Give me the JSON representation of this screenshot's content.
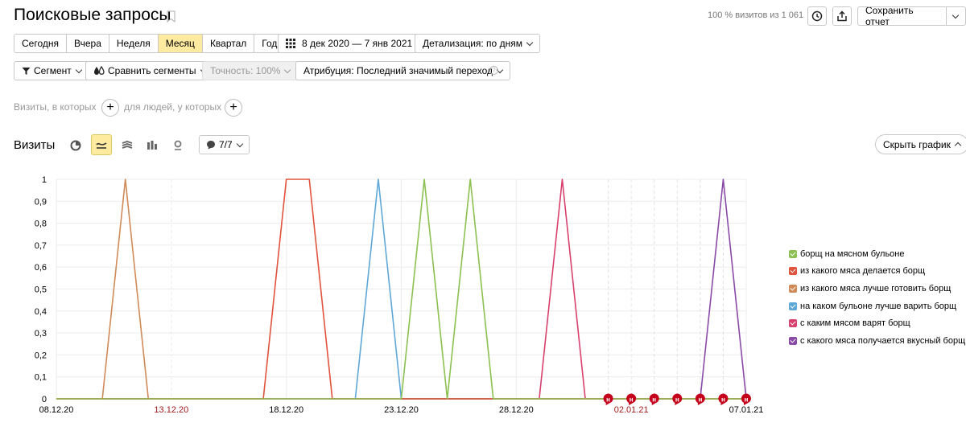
{
  "page": {
    "title": "Поисковые запросы",
    "visits_info": "100 % визитов из 1 061",
    "save_report": "Сохранить отчет"
  },
  "periods": [
    "Сегодня",
    "Вчера",
    "Неделя",
    "Месяц",
    "Квартал",
    "Год"
  ],
  "active_period": "Месяц",
  "date_range": "8 дек 2020 — 7 янв 2021",
  "detail": "Детализация: по дням",
  "filters": {
    "segment": "Сегмент",
    "compare": "Сравнить сегменты",
    "accuracy": "Точность: 100%",
    "attribution": "Атрибуция: Последний значимый переход",
    "visits_where": "Визиты, в которых",
    "people_where": "для людей, у которых"
  },
  "chart_section": {
    "title": "Визиты",
    "series_count": "7/7",
    "hide_chart": "Скрыть график"
  },
  "colors": {
    "active_bg": "#ffeba0",
    "holiday_red": "#a01a1a",
    "marker_red": "#c5001a"
  },
  "chart_data": {
    "type": "line",
    "title": "",
    "x": [
      "08.12.20",
      "09.12.20",
      "10.12.20",
      "11.12.20",
      "12.12.20",
      "13.12.20",
      "14.12.20",
      "15.12.20",
      "16.12.20",
      "17.12.20",
      "18.12.20",
      "19.12.20",
      "20.12.20",
      "21.12.20",
      "22.12.20",
      "23.12.20",
      "24.12.20",
      "25.12.20",
      "26.12.20",
      "27.12.20",
      "28.12.20",
      "29.12.20",
      "30.12.20",
      "31.12.20",
      "01.01.21",
      "02.01.21",
      "03.01.21",
      "04.01.21",
      "05.01.21",
      "06.01.21",
      "07.01.21"
    ],
    "x_tick_labels": [
      {
        "index": 0,
        "label": "08.12.20",
        "holiday": false
      },
      {
        "index": 5,
        "label": "13.12.20",
        "holiday": true
      },
      {
        "index": 10,
        "label": "18.12.20",
        "holiday": false
      },
      {
        "index": 15,
        "label": "23.12.20",
        "holiday": false
      },
      {
        "index": 20,
        "label": "28.12.20",
        "holiday": false
      },
      {
        "index": 25,
        "label": "02.01.21",
        "holiday": true
      },
      {
        "index": 30,
        "label": "07.01.21",
        "holiday": false
      }
    ],
    "ylim": [
      0,
      1
    ],
    "y_ticks": [
      "0",
      "0,1",
      "0,2",
      "0,3",
      "0,4",
      "0,5",
      "0,6",
      "0,7",
      "0,8",
      "0,9",
      "1"
    ],
    "grid": true,
    "legend_position": "right",
    "holiday_marker_label": "н",
    "holiday_markers": [
      24,
      25,
      26,
      27,
      28,
      29,
      30
    ],
    "series": [
      {
        "name": "борщ на мясном бульоне",
        "color": "#8cc152",
        "values": [
          0,
          0,
          0,
          0,
          0,
          0,
          0,
          0,
          0,
          0,
          0,
          0,
          0,
          0,
          0,
          0,
          1,
          0,
          1,
          0,
          0,
          0,
          0,
          0,
          0,
          0,
          0,
          0,
          0,
          0,
          0
        ]
      },
      {
        "name": "из какого мяса делается борщ",
        "color": "#e0533c",
        "values": [
          0,
          0,
          0,
          0,
          0,
          0,
          0,
          0,
          0,
          0,
          1,
          1,
          0,
          0,
          0,
          0,
          0,
          0,
          0,
          0,
          0,
          0,
          0,
          0,
          0,
          0,
          0,
          0,
          0,
          0,
          0
        ]
      },
      {
        "name": "из какого мяса лучше готовить борщ",
        "color": "#d08a58",
        "values": [
          0,
          0,
          0,
          1,
          0,
          0,
          0,
          0,
          0,
          0,
          0,
          0,
          0,
          0,
          0,
          0,
          0,
          0,
          0,
          0,
          0,
          0,
          0,
          0,
          0,
          0,
          0,
          0,
          0,
          0,
          0
        ]
      },
      {
        "name": "на каком бульоне лучше варить борщ",
        "color": "#5ea8d8",
        "values": [
          0,
          0,
          0,
          0,
          0,
          0,
          0,
          0,
          0,
          0,
          0,
          0,
          0,
          0,
          1,
          0,
          0,
          0,
          0,
          0,
          0,
          0,
          0,
          0,
          0,
          0,
          0,
          0,
          0,
          0,
          0
        ]
      },
      {
        "name": "с каким мясом варят борщ",
        "color": "#d8406e",
        "values": [
          0,
          0,
          0,
          0,
          0,
          0,
          0,
          0,
          0,
          0,
          0,
          0,
          0,
          0,
          0,
          0,
          0,
          0,
          0,
          0,
          0,
          0,
          1,
          0,
          0,
          0,
          0,
          0,
          0,
          0,
          0
        ]
      },
      {
        "name": "с какого мяса получается вкусный борщ",
        "color": "#8a4aa8",
        "values": [
          0,
          0,
          0,
          0,
          0,
          0,
          0,
          0,
          0,
          0,
          0,
          0,
          0,
          0,
          0,
          0,
          0,
          0,
          0,
          0,
          0,
          0,
          0,
          0,
          0,
          0,
          0,
          0,
          0,
          1,
          0
        ]
      }
    ]
  }
}
